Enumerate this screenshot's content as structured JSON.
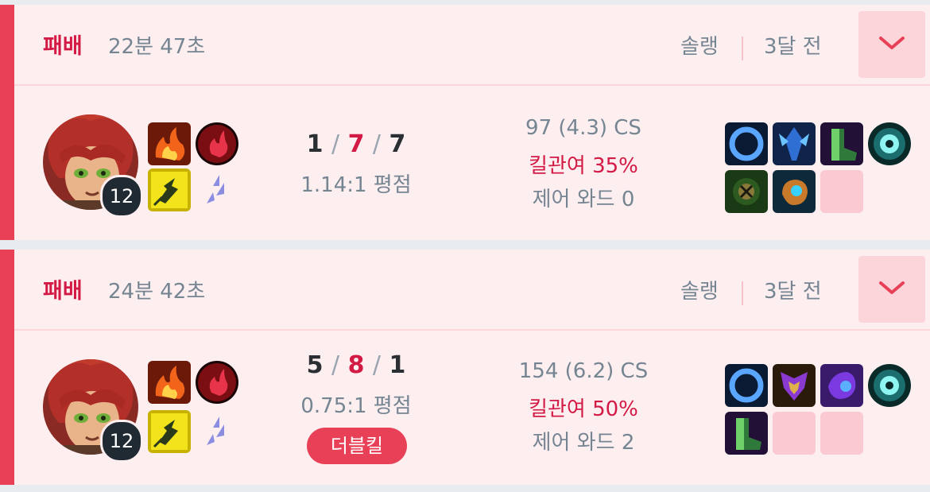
{
  "matches": [
    {
      "result": "패배",
      "duration": "22분 47초",
      "queue": "솔랭",
      "ago": "3달 전",
      "level": "12",
      "kills": "1",
      "deaths": "7",
      "assists": "7",
      "ratio": "1.14:1 평점",
      "cs": "97 (4.3) CS",
      "kill_participation": "킬관여 35%",
      "control_wards": "제어 와드 0",
      "badge": ""
    },
    {
      "result": "패배",
      "duration": "24분 42초",
      "queue": "솔랭",
      "ago": "3달 전",
      "level": "12",
      "kills": "5",
      "deaths": "8",
      "assists": "1",
      "ratio": "0.75:1 평점",
      "cs": "154 (6.2) CS",
      "kill_participation": "킬관여 50%",
      "control_wards": "제어 와드 2",
      "badge": "더블킬"
    }
  ],
  "slash": "/",
  "icons": {
    "expand": "chevron-down-icon",
    "spell1": "ignite-spell-icon",
    "spell2": "flash-spell-icon",
    "rune_primary": "electrocute-rune-icon",
    "rune_secondary": "sorcery-rune-icon"
  },
  "colors": {
    "loss_accent": "#e84057",
    "loss_background": "#fdeef0",
    "loss_text": "#d31a45",
    "muted_text": "#758592",
    "empty_slot": "#fbc9d2"
  }
}
